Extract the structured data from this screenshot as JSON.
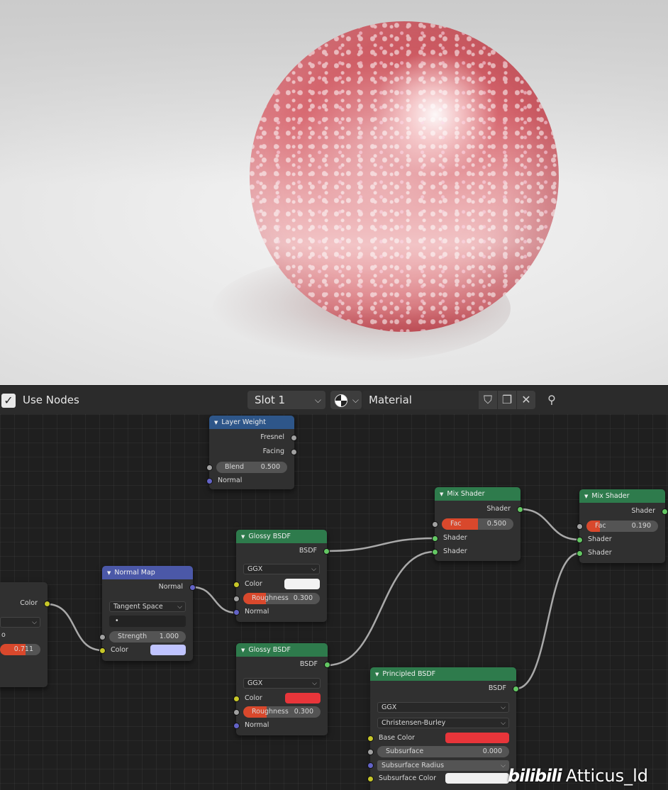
{
  "header": {
    "use_nodes_label": "Use Nodes",
    "use_nodes_checked": true,
    "slot": "Slot 1",
    "material_name": "Material"
  },
  "nodes": {
    "layer_weight": {
      "title": "Layer Weight",
      "out_fresnel": "Fresnel",
      "out_facing": "Facing",
      "blend_label": "Blend",
      "blend_value": "0.500",
      "in_normal": "Normal"
    },
    "image_partial": {
      "out_color": "Color",
      "factor_value": "0.711"
    },
    "normal_map": {
      "title": "Normal Map",
      "out_normal": "Normal",
      "space": "Tangent Space",
      "uv": "•",
      "strength_label": "Strength",
      "strength_value": "1.000",
      "in_color": "Color",
      "color": "#c0c4ff"
    },
    "glossy_1": {
      "title": "Glossy BSDF",
      "out_bsdf": "BSDF",
      "distribution": "GGX",
      "color_label": "Color",
      "roughness_label": "Roughness",
      "roughness_value": "0.300",
      "roughness": 0.3,
      "in_normal": "Normal",
      "color": "#f2f2f2"
    },
    "glossy_2": {
      "title": "Glossy BSDF",
      "out_bsdf": "BSDF",
      "distribution": "GGX",
      "color_label": "Color",
      "roughness_label": "Roughness",
      "roughness_value": "0.300",
      "roughness": 0.3,
      "in_normal": "Normal",
      "color": "#e8353a"
    },
    "mix_1": {
      "title": "Mix Shader",
      "out_shader": "Shader",
      "fac_label": "Fac",
      "fac_value": "0.500",
      "fac": 0.5,
      "in_shader_1": "Shader",
      "in_shader_2": "Shader"
    },
    "mix_2": {
      "title": "Mix Shader",
      "out_shader": "Shader",
      "fac_label": "Fac",
      "fac_value": "0.190",
      "fac": 0.19,
      "in_shader_1": "Shader",
      "in_shader_2": "Shader"
    },
    "principled": {
      "title": "Principled BSDF",
      "out_bsdf": "BSDF",
      "distribution": "GGX",
      "subsurface_method": "Christensen-Burley",
      "base_color_label": "Base Color",
      "base_color": "#e8353a",
      "subsurface_label": "Subsurface",
      "subsurface_value": "0.000",
      "subsurface_radius_label": "Subsurface Radius",
      "subsurface_color_label": "Subsurface Color",
      "subsurface_color": "#f0f0f0"
    }
  },
  "watermark": {
    "logo": "bilibili",
    "user": "Atticus_ld"
  }
}
